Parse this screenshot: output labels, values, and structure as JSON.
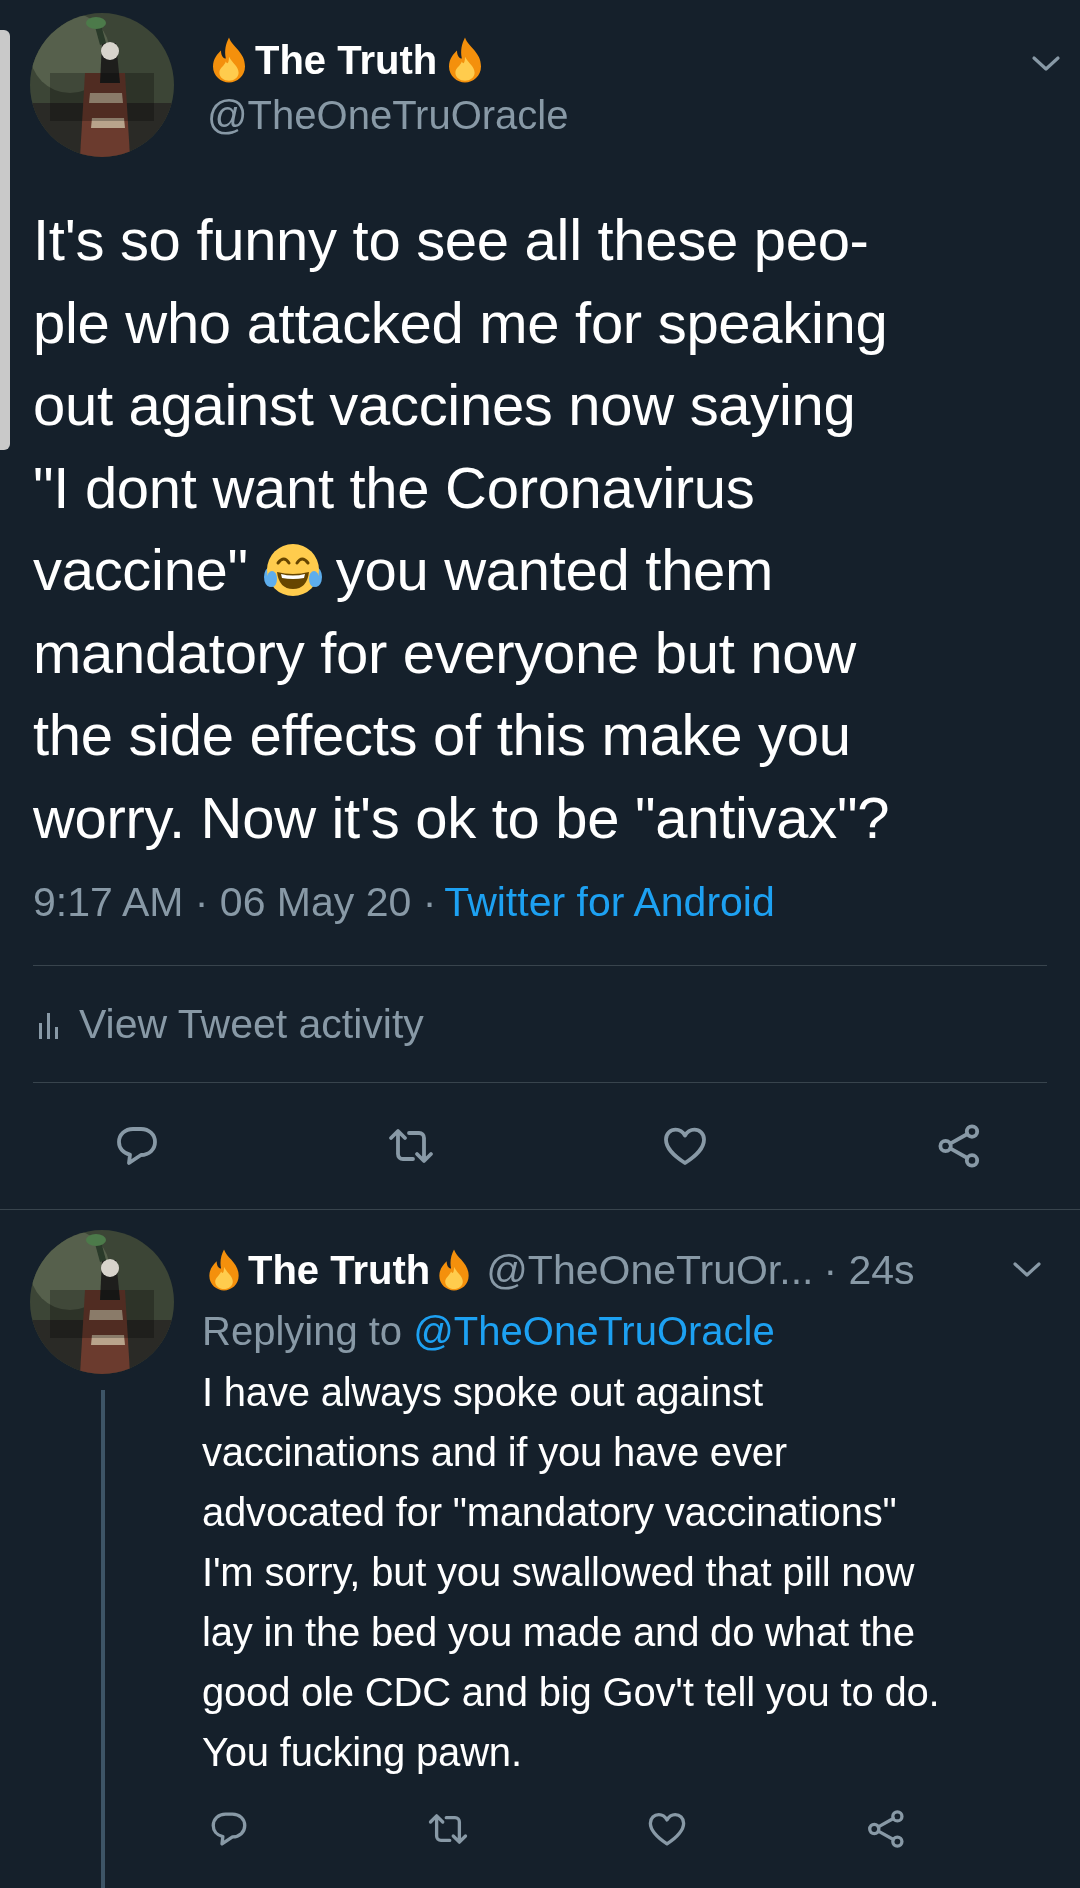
{
  "main_tweet": {
    "display_name": "The Truth",
    "handle": "@TheOneTruOracle",
    "lines": [
      [
        {
          "kind": "text",
          "text": "It's so funny to see all these peo-"
        }
      ],
      [
        {
          "kind": "text",
          "text": "ple who attacked me for speaking"
        }
      ],
      [
        {
          "kind": "text",
          "text": "out against vaccines now saying"
        }
      ],
      [
        {
          "kind": "text",
          "text": "\"I dont want the Coronavirus"
        }
      ],
      [
        {
          "kind": "text",
          "text": "vaccine\""
        },
        {
          "kind": "emoji"
        },
        {
          "kind": "text",
          "text": "you wanted them"
        }
      ],
      [
        {
          "kind": "text",
          "text": "mandatory for everyone but now"
        }
      ],
      [
        {
          "kind": "text",
          "text": "the side effects of this make you"
        }
      ],
      [
        {
          "kind": "text",
          "text": "worry. Now it's ok to be \"antivax\"?"
        }
      ]
    ],
    "meta": "9:17 AM · 06 May 20 ·",
    "source": "Twitter for Android",
    "activity": "View Tweet activity"
  },
  "reply": {
    "display_name": "The Truth",
    "handle": "@TheOneTruOr...",
    "age": "· 24s",
    "replying_prefix": "Replying to",
    "replying_to": "@TheOneTruOracle",
    "lines": [
      "I have always spoke out against",
      "vaccinations and if you have ever",
      "advocated for \"mandatory vaccinations\"",
      "I'm sorry, but you swallowed that pill now",
      "lay in the bed you made and do what the",
      "good ole CDC and big Gov't tell you to do.",
      "You fucking pawn."
    ]
  }
}
